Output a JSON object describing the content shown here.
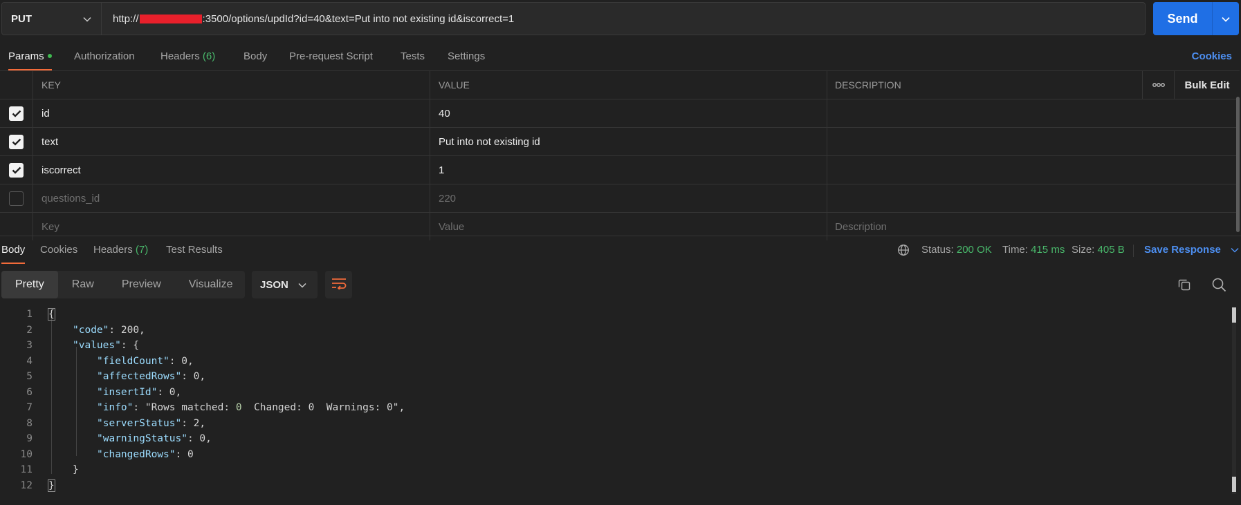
{
  "request": {
    "method": "PUT",
    "url_prefix": "http://",
    "url_suffix": ":3500/options/updId?id=40&text=Put into not existing id&iscorrect=1",
    "send_label": "Send"
  },
  "request_tabs": [
    {
      "label": "Params",
      "active": true
    },
    {
      "label": "Authorization"
    },
    {
      "label": "Headers",
      "count": "(6)"
    },
    {
      "label": "Body"
    },
    {
      "label": "Pre-request Script"
    },
    {
      "label": "Tests"
    },
    {
      "label": "Settings"
    }
  ],
  "cookies_link": "Cookies",
  "params": {
    "headers": {
      "key": "KEY",
      "value": "VALUE",
      "description": "DESCRIPTION",
      "bulk_edit": "Bulk Edit"
    },
    "rows": [
      {
        "key": "id",
        "value": "40",
        "checked": true
      },
      {
        "key": "text",
        "value": "Put into not existing id",
        "checked": true
      },
      {
        "key": "iscorrect",
        "value": "1",
        "checked": true
      },
      {
        "key": "questions_id",
        "value": "220",
        "checked": false
      }
    ],
    "placeholders": {
      "key": "Key",
      "value": "Value",
      "description": "Description"
    }
  },
  "response_tabs": [
    {
      "label": "Body",
      "active": true
    },
    {
      "label": "Cookies"
    },
    {
      "label": "Headers",
      "count": "(7)"
    },
    {
      "label": "Test Results"
    }
  ],
  "response_meta": {
    "status_label": "Status:",
    "status_value": "200 OK",
    "time_label": "Time:",
    "time_value": "415 ms",
    "size_label": "Size:",
    "size_value": "405 B",
    "save_response": "Save Response"
  },
  "format_modes": [
    "Pretty",
    "Raw",
    "Preview",
    "Visualize"
  ],
  "selected_format_mode": "Pretty",
  "language": "JSON",
  "colors": {
    "accent_orange": "#f26b3a",
    "send_blue": "#1f6fe5",
    "link_blue": "#4d8ff1",
    "status_green": "#49b86b"
  },
  "body_lines": [
    "{",
    "\"code\": 200,",
    "\"values\": {",
    "\"fieldCount\": 0,",
    "\"affectedRows\": 0,",
    "\"insertId\": 0,",
    "\"info\": \"Rows matched: 0  Changed: 0  Warnings: 0\",",
    "\"serverStatus\": 2,",
    "\"warningStatus\": 0,",
    "\"changedRows\": 0",
    "}",
    "}"
  ]
}
